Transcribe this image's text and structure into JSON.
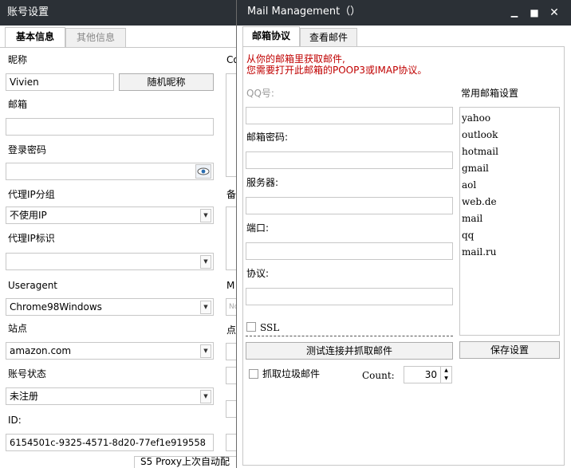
{
  "account_window": {
    "title": "账号设置",
    "tabs": [
      {
        "label": "基本信息",
        "active": true
      },
      {
        "label": "其他信息",
        "active": false
      }
    ],
    "nickname": {
      "label": "昵称",
      "value": "Vivien",
      "random_button": "随机昵称"
    },
    "email": {
      "label": "邮箱",
      "value": ""
    },
    "password": {
      "label": "登录密码",
      "value": "",
      "eye_icon": "eye-icon"
    },
    "proxy_group": {
      "label": "代理IP分组",
      "value": "不使用IP"
    },
    "proxy_tag": {
      "label": "代理IP标识",
      "value": ""
    },
    "useragent": {
      "label": "Useragent",
      "value": "Chrome98Windows"
    },
    "site": {
      "label": "站点",
      "value": "amazon.com"
    },
    "status": {
      "label": "账号状态",
      "value": "未注册"
    },
    "id": {
      "label": "ID:",
      "value": "6154501c-9325-4571-8d20-77ef1e919558"
    },
    "bottom_partial": "S5 Proxy上次自动配",
    "right_partial_labels": {
      "c1": "Co",
      "c2": "备",
      "c3": "M",
      "c4": "点",
      "c5": "No"
    }
  },
  "mail_window": {
    "title": "Mail Management（）",
    "controls": {
      "minimize": "▁",
      "maximize": "■",
      "close": "✕"
    },
    "tabs": [
      {
        "label": "邮箱协议",
        "active": true
      },
      {
        "label": "查看邮件",
        "active": false
      }
    ],
    "notice_line1": "从你的邮箱里获取邮件,",
    "notice_line2": "您需要打开此邮箱的POOP3或IMAP协议。",
    "qq_label": "QQ号:",
    "password_label": "邮箱密码:",
    "server_label": "服务器:",
    "port_label": "端口:",
    "protocol_label": "协议:",
    "ssl_label": "SSL",
    "test_button": "测试连接并抓取邮件",
    "junk_label": "抓取垃圾邮件",
    "count_label": "Count:",
    "count_value": "30",
    "common_title": "常用邮箱设置",
    "common_list": [
      "yahoo",
      "outlook",
      "hotmail",
      "gmail",
      "aol",
      "web.de",
      "mail",
      "qq",
      "mail.ru"
    ],
    "save_button": "保存设置"
  }
}
